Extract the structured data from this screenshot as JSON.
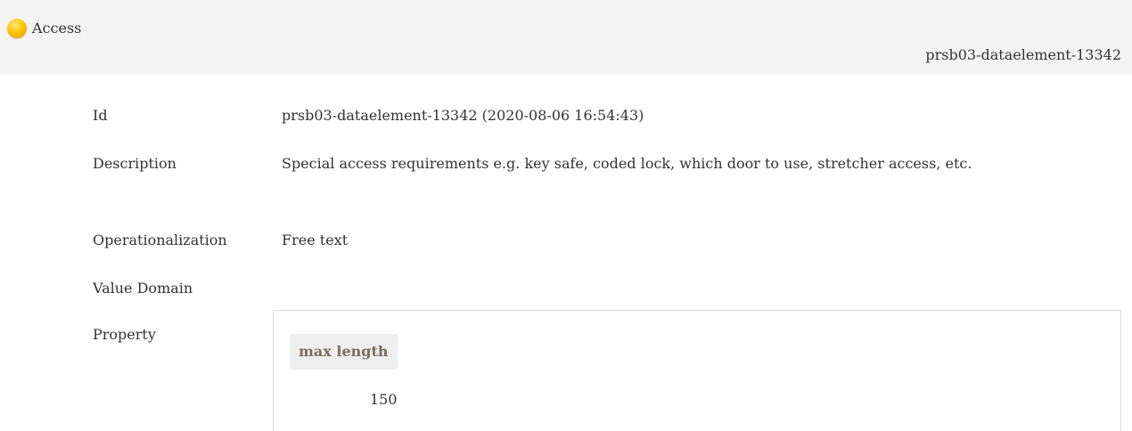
{
  "header": {
    "title": "Access",
    "element_id": "prsb03-dataelement-13342",
    "status_color": "#ffc400"
  },
  "rows": [
    {
      "label": "Id",
      "value": "prsb03-dataelement-13342 (2020-08-06 16:54:43)"
    },
    {
      "label": "Description",
      "value": "Special access requirements e.g. key safe, coded lock, which door to use, stretcher access, etc."
    },
    {
      "label": "Operationalization",
      "value": "Free text"
    },
    {
      "label": "Value Domain",
      "value": ""
    },
    {
      "label": "Property",
      "value": ""
    }
  ],
  "property_table": {
    "column_header": "max length",
    "value": "150"
  }
}
